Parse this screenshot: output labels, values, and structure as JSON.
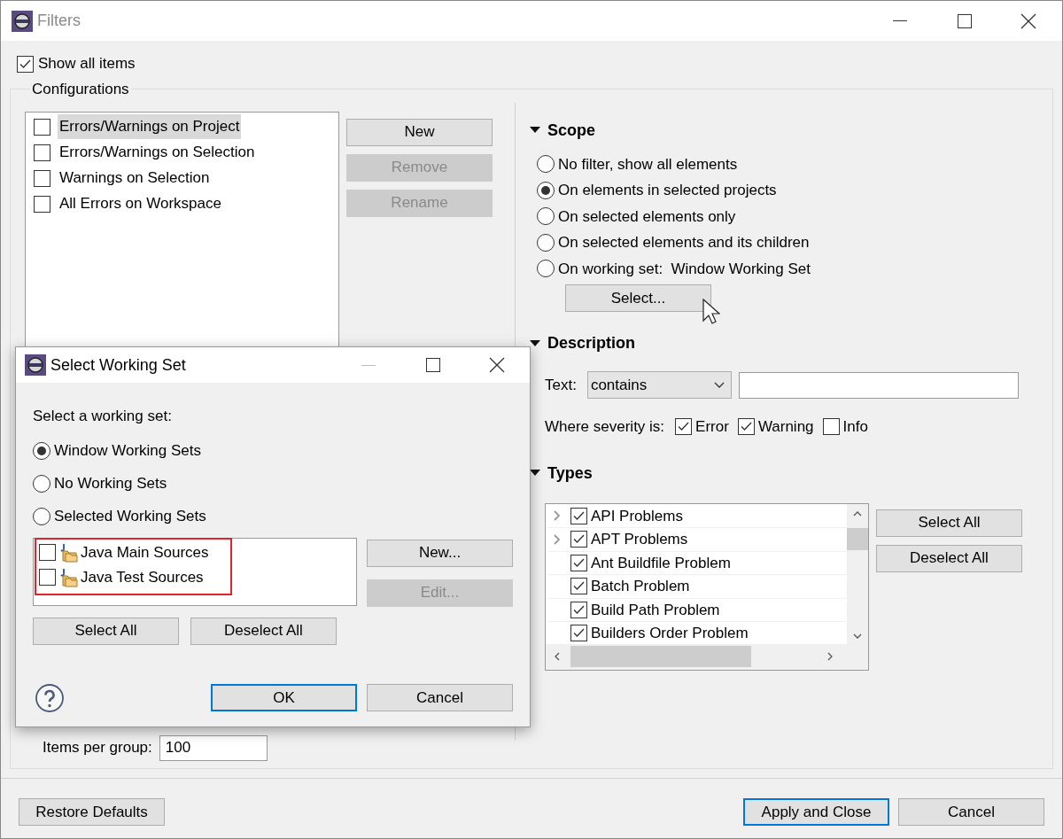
{
  "window": {
    "title": "Filters"
  },
  "show_all_items": {
    "label": "Show all items",
    "checked": true
  },
  "configurations": {
    "title": "Configurations",
    "items": [
      {
        "label": "Errors/Warnings on Project",
        "checked": false,
        "selected": true
      },
      {
        "label": "Errors/Warnings on Selection",
        "checked": false,
        "selected": false
      },
      {
        "label": "Warnings on Selection",
        "checked": false,
        "selected": false
      },
      {
        "label": "All Errors on Workspace",
        "checked": false,
        "selected": false
      }
    ],
    "buttons": [
      {
        "label": "New",
        "disabled": false
      },
      {
        "label": "Remove",
        "disabled": true
      },
      {
        "label": "Rename",
        "disabled": true
      }
    ]
  },
  "scope": {
    "title": "Scope",
    "expanded": true,
    "options": [
      {
        "label": "No filter, show all elements",
        "selected": false
      },
      {
        "label": "On elements in selected projects",
        "selected": true
      },
      {
        "label": "On selected elements only",
        "selected": false
      },
      {
        "label": "On selected elements and its children",
        "selected": false
      },
      {
        "label": "On working set:  Window Working Set",
        "selected": false
      }
    ],
    "select_button": "Select..."
  },
  "description": {
    "title": "Description",
    "expanded": true,
    "text_label": "Text:",
    "match": "contains",
    "severity_label": "Where severity is:",
    "severities": [
      {
        "label": "Error",
        "checked": true
      },
      {
        "label": "Warning",
        "checked": true
      },
      {
        "label": "Info",
        "checked": false
      }
    ]
  },
  "types": {
    "title": "Types",
    "expanded": true,
    "items": [
      {
        "label": "API Problems",
        "checked": true,
        "expandable": true
      },
      {
        "label": "APT Problems",
        "checked": true,
        "expandable": true
      },
      {
        "label": "Ant Buildfile Problem",
        "checked": true,
        "expandable": false
      },
      {
        "label": "Batch Problem",
        "checked": true,
        "expandable": false
      },
      {
        "label": "Build Path Problem",
        "checked": true,
        "expandable": false
      },
      {
        "label": "Builders Order Problem",
        "checked": true,
        "expandable": false
      }
    ],
    "buttons": [
      "Select All",
      "Deselect All"
    ]
  },
  "items_per_group": {
    "label": "Items per group:",
    "value": "100"
  },
  "footer": {
    "restore": "Restore Defaults",
    "buttons": [
      {
        "label": "Apply and Close",
        "default": true
      },
      {
        "label": "Cancel",
        "default": false
      }
    ]
  },
  "dialog": {
    "title": "Select Working Set",
    "prompt": "Select a working set:",
    "options": [
      {
        "label": "Window Working Sets",
        "selected": true
      },
      {
        "label": "No Working Sets",
        "selected": false
      },
      {
        "label": "Selected Working Sets",
        "selected": false
      }
    ],
    "working_sets": [
      {
        "label": "Java Main Sources",
        "checked": false
      },
      {
        "label": "Java Test Sources",
        "checked": false
      }
    ],
    "highlighted": true,
    "side_buttons": [
      {
        "label": "New...",
        "disabled": false
      },
      {
        "label": "Edit...",
        "disabled": true
      }
    ],
    "select_buttons": [
      "Select All",
      "Deselect All"
    ],
    "buttons": [
      {
        "label": "OK",
        "default": true
      },
      {
        "label": "Cancel",
        "default": false
      }
    ]
  }
}
